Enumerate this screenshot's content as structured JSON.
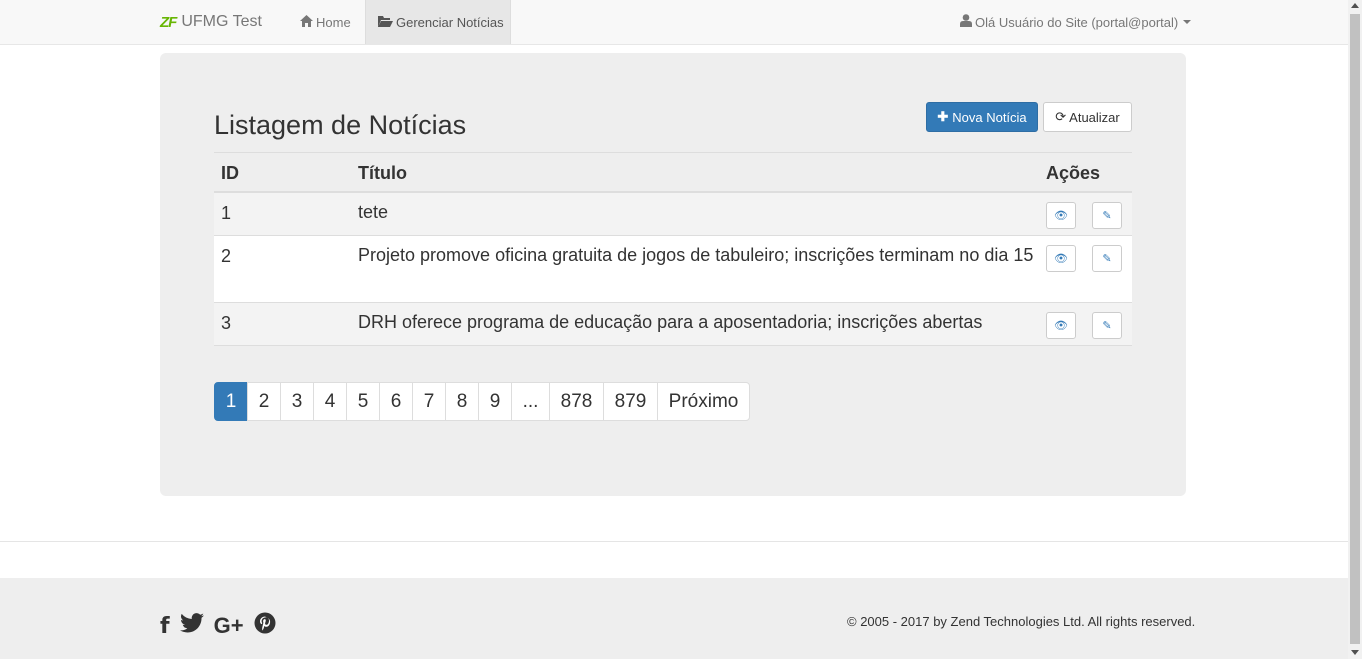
{
  "navbar": {
    "brand_logo": "ZF",
    "brand": "UFMG Test",
    "home_label": "Home",
    "news_label": "Gerenciar Notícias",
    "user_label": "Olá Usuário do Site (portal@portal)"
  },
  "page": {
    "title": "Listagem de Notícias",
    "new_button": "Nova Notícia",
    "refresh_button": "Atualizar"
  },
  "table": {
    "headers": {
      "id": "ID",
      "title": "Título",
      "actions": "Ações"
    },
    "rows": [
      {
        "id": "1",
        "title": "tete"
      },
      {
        "id": "2",
        "title": "Projeto promove oficina gratuita de jogos de tabuleiro; inscrições terminam no dia 15"
      },
      {
        "id": "3",
        "title": "DRH oferece programa de educação para a aposentadoria; inscrições abertas"
      }
    ]
  },
  "pagination": [
    "1",
    "2",
    "3",
    "4",
    "5",
    "6",
    "7",
    "8",
    "9",
    "...",
    "878",
    "879",
    "Próximo"
  ],
  "footer": {
    "social_icons": [
      "facebook-icon",
      "twitter-icon",
      "google-plus-icon",
      "pinterest-icon"
    ],
    "copyright": "© 2005 - 2017 by Zend Technologies Ltd. All rights reserved."
  },
  "colors": {
    "primary": "#337ab7",
    "panel": "#eeeeee",
    "navbar": "#f8f8f8"
  }
}
